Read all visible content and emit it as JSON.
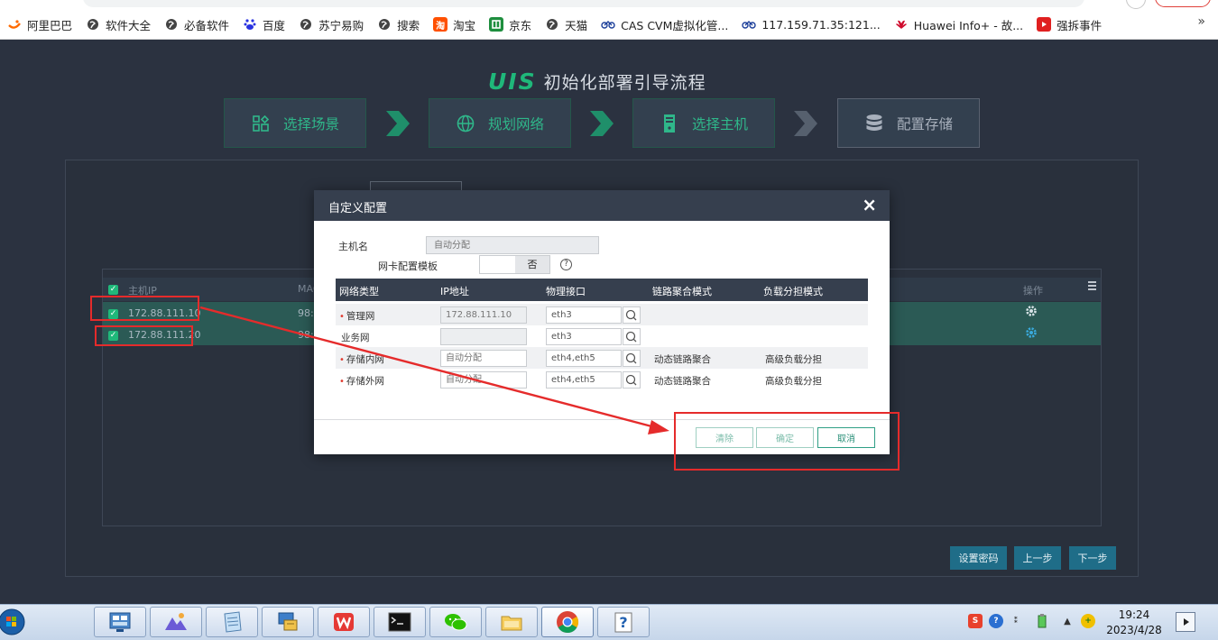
{
  "bookmarks": [
    {
      "label": "阿里巴巴",
      "icon": "alibaba-icon",
      "color": "#ff6a00"
    },
    {
      "label": "软件大全",
      "icon": "globe-icon",
      "color": "#444444"
    },
    {
      "label": "必备软件",
      "icon": "globe-icon",
      "color": "#444444"
    },
    {
      "label": "百度",
      "icon": "baidu-icon",
      "color": "#2932e1"
    },
    {
      "label": "苏宁易购",
      "icon": "globe-icon",
      "color": "#444444"
    },
    {
      "label": "搜索",
      "icon": "globe-icon",
      "color": "#444444"
    },
    {
      "label": "淘宝",
      "icon": "taobao-icon",
      "color": "#ff5000"
    },
    {
      "label": "京东",
      "icon": "jd-icon",
      "color": "#1e8e3e"
    },
    {
      "label": "天猫",
      "icon": "globe-icon",
      "color": "#444444"
    },
    {
      "label": "CAS CVM虚拟化管...",
      "icon": "bike-icon",
      "color": "#1c3f9a"
    },
    {
      "label": "117.159.71.35:121...",
      "icon": "bike-icon",
      "color": "#1c3f9a"
    },
    {
      "label": "Huawei Info+ - 故...",
      "icon": "huawei-icon",
      "color": "#cf0a2c"
    },
    {
      "label": "强拆事件",
      "icon": "video-icon",
      "color": "#e02020"
    }
  ],
  "bookmarks_more": "»",
  "header": {
    "logo": "UIS",
    "title": "初始化部署引导流程"
  },
  "steps": [
    {
      "label": "选择场景",
      "icon": "scene-icon"
    },
    {
      "label": "规划网络",
      "icon": "globe-icon"
    },
    {
      "label": "选择主机",
      "icon": "server-icon"
    },
    {
      "label": "配置存储",
      "icon": "database-icon"
    }
  ],
  "host_table": {
    "col_ip": "主机IP",
    "col_mac": "MAC",
    "col_ops": "操作",
    "rows": [
      {
        "ip": "172.88.111.10",
        "mac": "98:e"
      },
      {
        "ip": "172.88.111.20",
        "mac": "98:e"
      }
    ]
  },
  "bottom_buttons": {
    "set_password": "设置密码",
    "prev": "上一步",
    "next": "下一步"
  },
  "modal": {
    "title": "自定义配置",
    "close": "×",
    "hostname_label": "主机名",
    "hostname_placeholder": "自动分配",
    "nic_template_label": "网卡配置模板",
    "nic_template_value": "否",
    "help": "?",
    "columns": [
      "网络类型",
      "IP地址",
      "物理接口",
      "链路聚合模式",
      "负载分担模式"
    ],
    "rows": [
      {
        "required": "•",
        "type": "管理网",
        "ip": "172.88.111.10",
        "iface": "eth3",
        "agg": "",
        "lb": ""
      },
      {
        "required": "",
        "type": "业务网",
        "ip": "",
        "iface": "eth3",
        "agg": "",
        "lb": ""
      },
      {
        "required": "•",
        "type": "存储内网",
        "ip_placeholder": "自动分配",
        "iface": "eth4,eth5",
        "agg": "动态链路聚合",
        "lb": "高级负载分担"
      },
      {
        "required": "•",
        "type": "存储外网",
        "ip_placeholder": "自动分配",
        "iface": "eth4,eth5",
        "agg": "动态链路聚合",
        "lb": "高级负载分担"
      }
    ],
    "buttons": {
      "clear": "清除",
      "confirm": "确定",
      "cancel": "取消"
    }
  },
  "taskbar": {
    "time": "19:24",
    "date": "2023/4/28"
  },
  "colors": {
    "accent_green": "#1fb87a",
    "panel_bg": "#2b3240",
    "annotation_red": "#e52b2b"
  }
}
